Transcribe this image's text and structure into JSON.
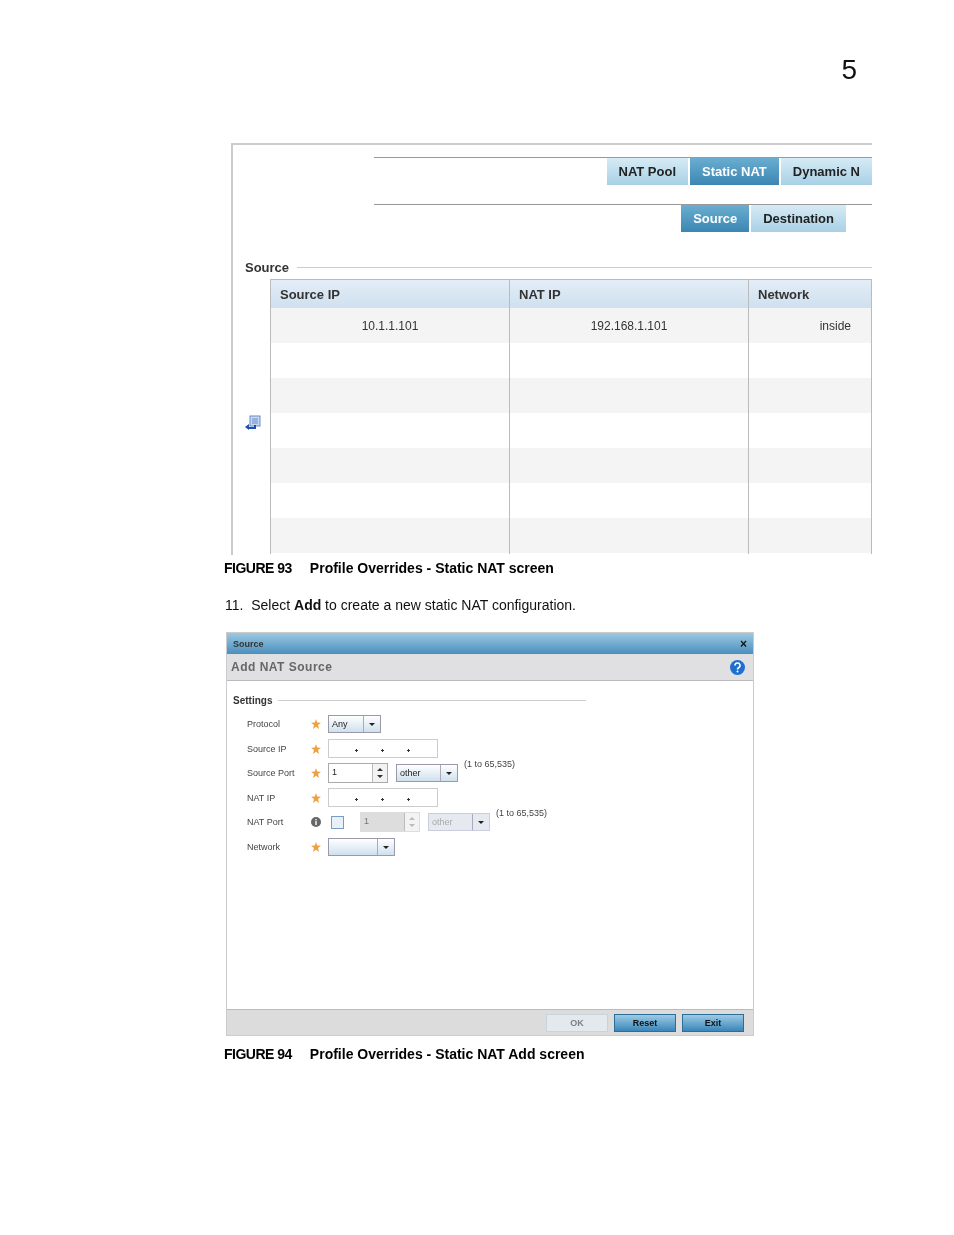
{
  "chapter": "5",
  "figure_93": {
    "tabs": [
      {
        "label": "NAT Pool",
        "selected": false
      },
      {
        "label": "Static NAT",
        "selected": true
      },
      {
        "label": "Dynamic N",
        "selected": false
      }
    ],
    "subtabs": [
      {
        "label": "Source",
        "selected": true
      },
      {
        "label": "Destination",
        "selected": false
      }
    ],
    "section": "Source",
    "table": {
      "columns": [
        "Source IP",
        "NAT IP",
        "Network"
      ],
      "rows": [
        [
          "10.1.1.101",
          "192.168.1.101",
          "inside"
        ]
      ]
    },
    "caption_label": "FIGURE 93",
    "caption": "Profile Overrides - Static NAT screen"
  },
  "step": {
    "number": "11.",
    "text": "Select **Add** to create a new static NAT configuration."
  },
  "figure_94": {
    "dialog_title": "Source",
    "close": "×",
    "header": "Add NAT Source",
    "section": "Settings",
    "fields": [
      {
        "label": "Protocol",
        "required": true,
        "kind": "select",
        "value": "Any"
      },
      {
        "label": "Source IP",
        "required": true,
        "kind": "ip"
      },
      {
        "label": "Source Port",
        "required": true,
        "kind": "port",
        "value": "1",
        "mode": "other",
        "range": "(1 to 65,535)",
        "disabled": false
      },
      {
        "label": "NAT IP",
        "required": true,
        "kind": "ip"
      },
      {
        "label": "NAT Port",
        "required": false,
        "kind": "port",
        "checked": false,
        "value": "1",
        "mode": "other",
        "range": "(1 to 65,535)",
        "disabled": true
      },
      {
        "label": "Network",
        "required": true,
        "kind": "select"
      }
    ],
    "buttons": [
      {
        "label": "OK",
        "disabled": true
      },
      {
        "label": "Reset",
        "disabled": false
      },
      {
        "label": "Exit",
        "disabled": false
      }
    ],
    "caption_label": "FIGURE 94",
    "caption": "Profile Overrides - Static NAT Add screen"
  }
}
